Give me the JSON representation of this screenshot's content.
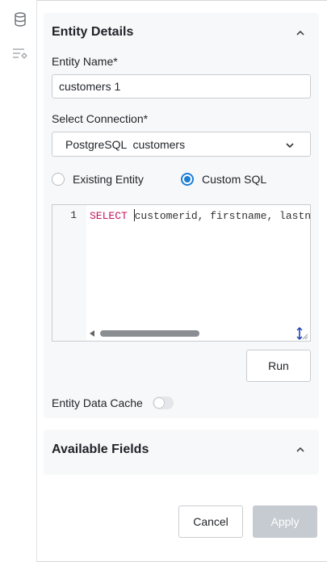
{
  "rail": {
    "icons": [
      "database-icon",
      "filter-settings-icon"
    ]
  },
  "entity_details": {
    "title": "Entity Details",
    "entity_name_label": "Entity Name*",
    "entity_name_value": "customers 1",
    "connection_label": "Select Connection*",
    "connection_value": "PostgreSQL  customers",
    "radio_existing": "Existing Entity",
    "radio_custom": "Custom SQL",
    "selected_mode": "Custom SQL",
    "editor": {
      "line_number": "1",
      "keyword": "SELECT",
      "code_rest": "customerid, firstname, lastna"
    },
    "run_label": "Run",
    "cache_label": "Entity Data Cache",
    "cache_enabled": false
  },
  "available_fields": {
    "title": "Available Fields"
  },
  "footer": {
    "cancel_label": "Cancel",
    "apply_label": "Apply"
  },
  "colors": {
    "accent": "#1c7ed6",
    "keyword": "#c2185b",
    "disabled": "#c6cbd1",
    "panel": "#f7f8f9"
  }
}
